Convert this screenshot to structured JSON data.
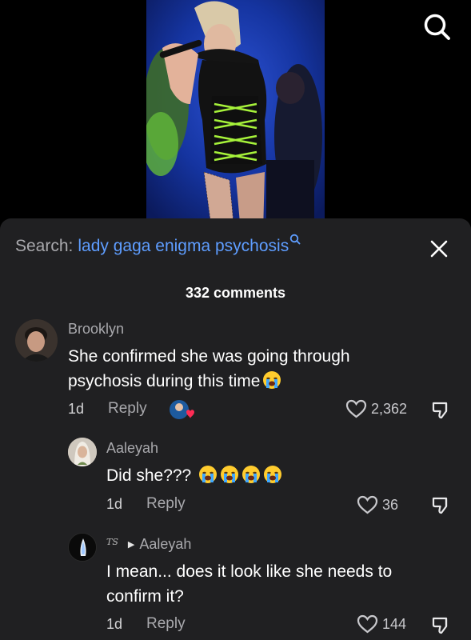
{
  "search": {
    "prefix": "Search:",
    "term": "lady gaga enigma psychosis"
  },
  "comments_header": {
    "count_label": "332 comments"
  },
  "comments": [
    {
      "username": "Brooklyn",
      "text": "She confirmed she was going through psychosis during this time",
      "time": "1d",
      "reply_label": "Reply",
      "likes": "2,362"
    },
    {
      "username": "Aaleyah",
      "text": "Did she???",
      "time": "1d",
      "reply_label": "Reply",
      "likes": "36"
    },
    {
      "username_mark": "TS",
      "reply_to": "Aaleyah",
      "text": "I mean... does it look like she needs to confirm it?",
      "time": "1d",
      "reply_label": "Reply",
      "likes": "144"
    }
  ],
  "colors": {
    "sheet_bg": "#202022",
    "search_term": "#5e9dff",
    "secondary_text": "#a9a9ad",
    "video_stage": "#1e3fb3"
  },
  "icons": [
    "search-icon",
    "close-icon",
    "heart-icon",
    "dislike-icon",
    "crying-emoji",
    "reply-arrow-icon"
  ]
}
